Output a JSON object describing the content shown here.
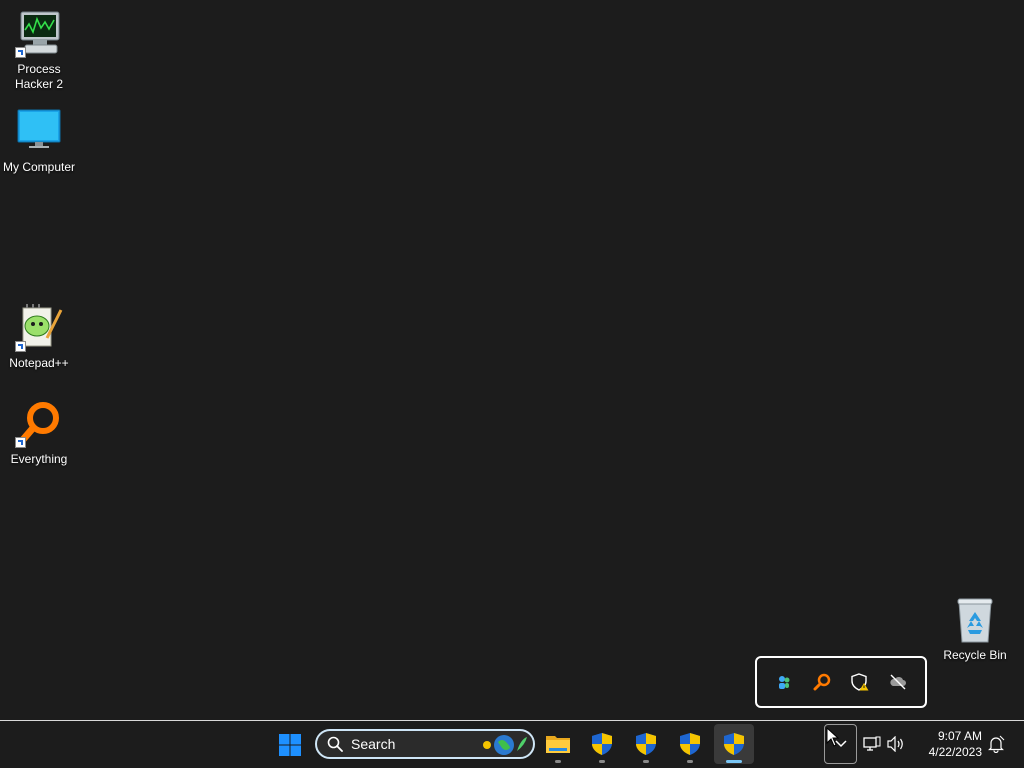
{
  "desktop": {
    "icons": [
      {
        "label": "Process\nHacker 2",
        "icon": "process-hacker-icon"
      },
      {
        "label": "My Computer",
        "icon": "monitor-icon"
      },
      {
        "label": "Notepad++",
        "icon": "notepad-plus-plus-icon"
      },
      {
        "label": "Everything",
        "icon": "everything-search-icon"
      },
      {
        "label": "Recycle Bin",
        "icon": "recycle-bin-icon"
      }
    ]
  },
  "tray_flyout": {
    "icons": [
      "people-sync-icon",
      "everything-tray-icon",
      "security-warning-icon",
      "onedrive-offline-icon"
    ]
  },
  "taskbar": {
    "search": {
      "label": "Search",
      "icon": "search-icon",
      "highlight": "earth-day-globe-icon"
    },
    "apps": [
      {
        "name": "file-explorer",
        "icon": "folder-icon",
        "active": false
      },
      {
        "name": "uac-shield-1",
        "icon": "uac-shield-icon",
        "active": false
      },
      {
        "name": "uac-shield-2",
        "icon": "uac-shield-icon",
        "active": false
      },
      {
        "name": "uac-shield-3",
        "icon": "uac-shield-icon",
        "active": false
      },
      {
        "name": "uac-shield-4",
        "icon": "uac-shield-icon",
        "active": true
      }
    ],
    "clock": {
      "time": "9:07 AM",
      "date": "4/22/2023"
    }
  },
  "colors": {
    "accent": "#7ac6f5",
    "desktop_bg": "#1c1c1c",
    "windows_blue": "#1e90ff",
    "shield_yellow": "#f5c400"
  }
}
